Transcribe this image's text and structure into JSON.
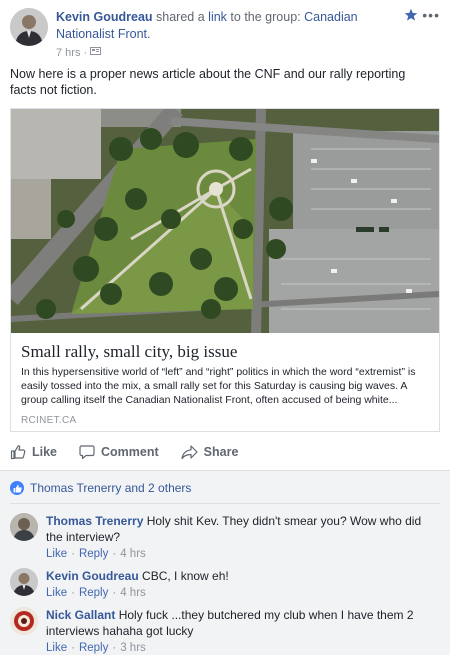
{
  "post": {
    "author": "Kevin Goudreau",
    "verb_shared": "shared a",
    "verb_link": "link",
    "verb_to": "to the group:",
    "group": "Canadian Nationalist Front.",
    "time": "7 hrs",
    "separator": "·",
    "more": "•••",
    "text": "Now here is a proper news article about the CNF and our rally reporting facts not fiction."
  },
  "card": {
    "title": "Small rally, small city, big issue",
    "description": "In this hypersensitive world of “left” and “right” politics in which the word “extremist” is easily tossed into the mix, a small rally set for this Saturday is causing big waves. A group calling itself the Canadian Nationalist Front, often accused of being white...",
    "domain": "RCINET.CA"
  },
  "actions": {
    "like": "Like",
    "comment": "Comment",
    "share": "Share"
  },
  "reactions": {
    "summary": "Thomas Trenerry and 2 others"
  },
  "comments": [
    {
      "author": "Thomas Trenerry",
      "text": "Holy shit Kev. They didn't smear you? Wow who did the interview?",
      "like": "Like",
      "reply": "Reply",
      "time": "4 hrs",
      "sep": "·"
    },
    {
      "author": "Kevin Goudreau",
      "text": "CBC, I know eh!",
      "like": "Like",
      "reply": "Reply",
      "time": "4 hrs",
      "sep": "·"
    },
    {
      "author": "Nick Gallant",
      "text": "Holy fuck ...they butchered my club when I have them 2 interviews hahaha got lucky",
      "like": "Like",
      "reply": "Reply",
      "time": "3 hrs",
      "sep": "·"
    }
  ],
  "colors": {
    "link_blue": "#365899",
    "like_badge": "#4080ff",
    "muted": "#90949c",
    "comments_bg": "#f2f3f5"
  },
  "icons": {
    "star": "star-icon",
    "audience": "audience-icon",
    "like": "thumbs-up-icon",
    "comment": "speech-bubble-icon",
    "share": "share-arrow-icon"
  }
}
